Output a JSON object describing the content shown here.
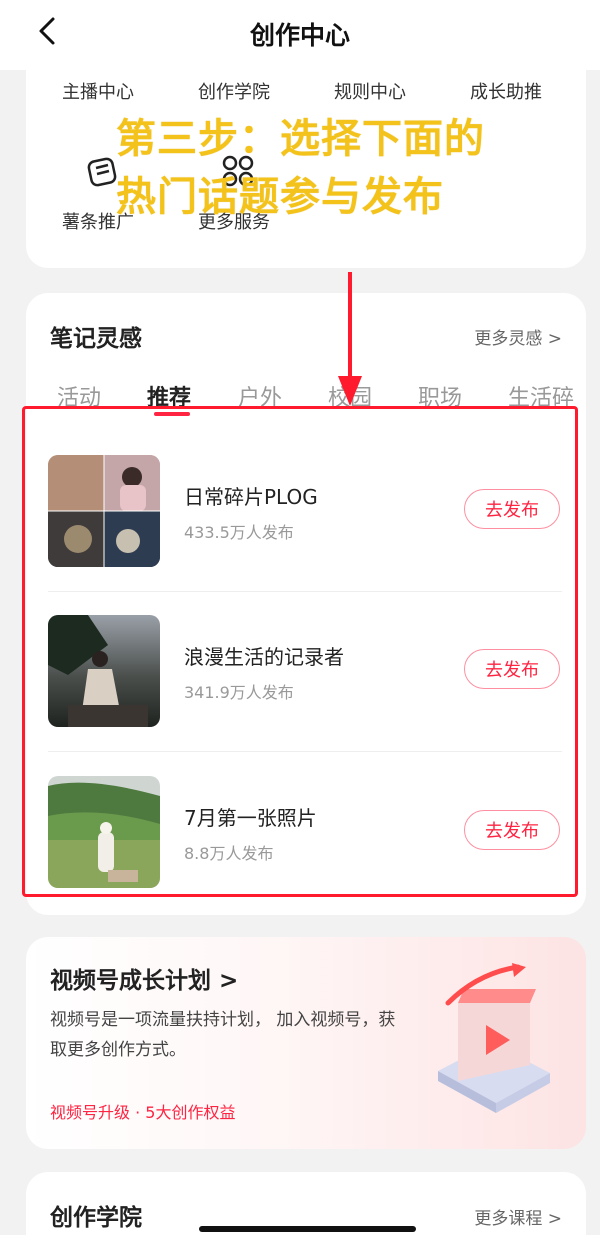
{
  "header": {
    "title": "创作中心"
  },
  "services": {
    "row1": [
      "主播中心",
      "创作学院",
      "规则中心",
      "成长助推"
    ],
    "row2": [
      "薯条推广",
      "更多服务"
    ]
  },
  "overlay_instruction": {
    "line1": "第三步：选择下面的",
    "line2": "热门话题参与发布"
  },
  "inspiration": {
    "title": "笔记灵感",
    "more": "更多灵感 >",
    "tabs": [
      "活动",
      "推荐",
      "户外",
      "校园",
      "职场",
      "生活碎"
    ],
    "active_tab": "推荐",
    "topics": [
      {
        "title": "日常碎片PLOG",
        "count": "433.5万人发布",
        "button": "去发布"
      },
      {
        "title": "浪漫生活的记录者",
        "count": "341.9万人发布",
        "button": "去发布"
      },
      {
        "title": "7月第一张照片",
        "count": "8.8万人发布",
        "button": "去发布"
      }
    ]
  },
  "video_plan": {
    "title": "视频号成长计划 >",
    "description": "视频号是一项流量扶持计划， 加入视频号，获取更多创作方式。",
    "link": "视频号升级 · 5大创作权益"
  },
  "academy": {
    "title": "创作学院",
    "more": "更多课程 >"
  },
  "colors": {
    "accent": "#ff2442",
    "overlay_text": "#f3c21b",
    "highlight": "#ff1a2e"
  }
}
